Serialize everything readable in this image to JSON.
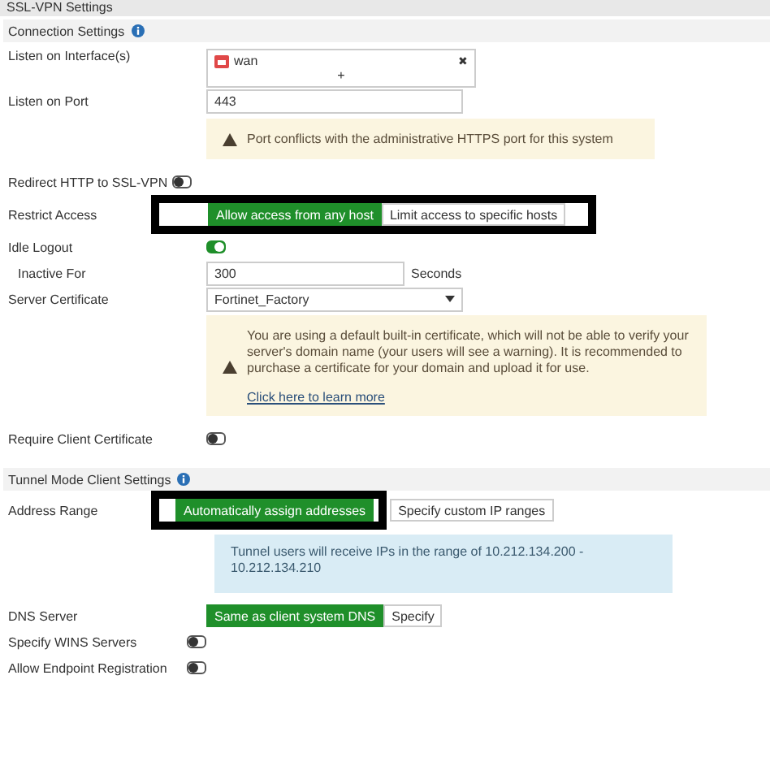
{
  "page_title": "SSL-VPN Settings",
  "connection": {
    "title": "Connection Settings",
    "interface": {
      "label": "Listen on Interface(s)",
      "value": "wan",
      "remove": "✖",
      "add": "+"
    },
    "port": {
      "label": "Listen on Port",
      "value": "443",
      "warning": "Port conflicts with the administrative HTTPS port for this system"
    },
    "redirect": {
      "label": "Redirect HTTP to SSL-VPN",
      "on": false
    },
    "restrict": {
      "label": "Restrict Access",
      "options": [
        {
          "label": "Allow access from any host",
          "selected": true
        },
        {
          "label": "Limit access to specific hosts",
          "selected": false
        }
      ]
    },
    "idle": {
      "label": "Idle Logout",
      "on": true
    },
    "inactive": {
      "label": "Inactive For",
      "value": "300",
      "unit": "Seconds"
    },
    "certificate": {
      "label": "Server Certificate",
      "value": "Fortinet_Factory",
      "warning": "You are using a default built-in certificate, which will not be able to verify your server's domain name (your users will see a warning). It is recommended to purchase a certificate for your domain and upload it for use.",
      "link": "Click here to learn more"
    },
    "client_cert": {
      "label": "Require Client Certificate",
      "on": false
    }
  },
  "tunnel": {
    "title": "Tunnel Mode Client Settings",
    "address": {
      "label": "Address Range",
      "options": [
        {
          "label": "Automatically assign addresses",
          "selected": true
        },
        {
          "label": "Specify custom IP ranges",
          "selected": false
        }
      ],
      "info": "Tunnel users will receive IPs in the range of 10.212.134.200 - 10.212.134.210"
    },
    "dns": {
      "label": "DNS Server",
      "options": [
        {
          "label": "Same as client system DNS",
          "selected": true
        },
        {
          "label": "Specify",
          "selected": false
        }
      ]
    },
    "wins": {
      "label": "Specify WINS Servers",
      "on": false
    },
    "endpoint": {
      "label": "Allow Endpoint Registration",
      "on": false
    }
  }
}
